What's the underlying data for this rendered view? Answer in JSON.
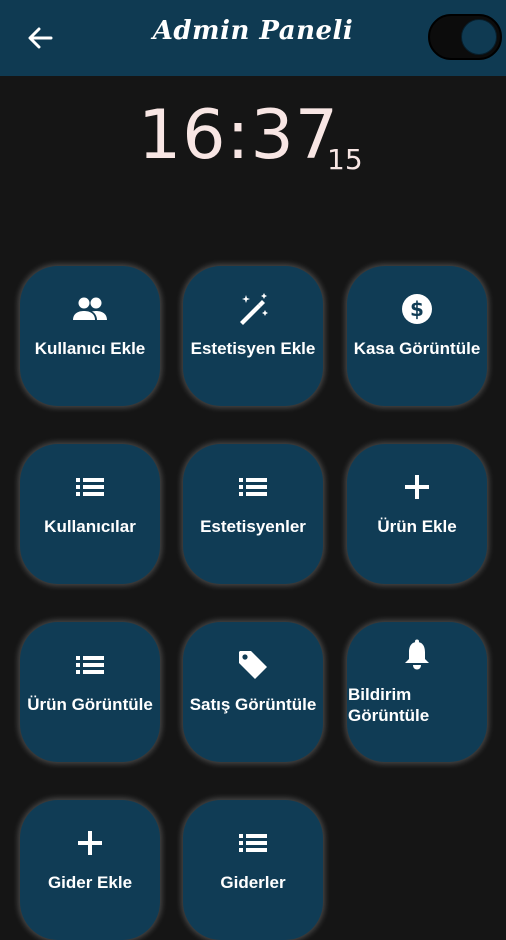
{
  "appbar": {
    "title": "Admin Paneli"
  },
  "clock": {
    "time": "16:37",
    "seconds": "15"
  },
  "tiles": [
    {
      "label": "Kullanıcı Ekle",
      "icon": "people-icon"
    },
    {
      "label": "Estetisyen Ekle",
      "icon": "magic-wand-icon"
    },
    {
      "label": "Kasa Görüntüle",
      "icon": "dollar-icon"
    },
    {
      "label": "Kullanıcılar",
      "icon": "list-icon"
    },
    {
      "label": "Estetisyenler",
      "icon": "list-icon"
    },
    {
      "label": "Ürün Ekle",
      "icon": "plus-icon"
    },
    {
      "label": "Ürün Görüntüle",
      "icon": "list-icon"
    },
    {
      "label": "Satış Görüntüle",
      "icon": "tag-icon"
    },
    {
      "label": "Bildirim Görüntüle",
      "icon": "bell-icon"
    },
    {
      "label": "Gider Ekle",
      "icon": "plus-icon"
    },
    {
      "label": "Giderler",
      "icon": "list-icon"
    }
  ],
  "colors": {
    "appbar": "#0f3a52",
    "tile": "#103c55",
    "background": "#151515",
    "clock": "#f8e6e4"
  }
}
